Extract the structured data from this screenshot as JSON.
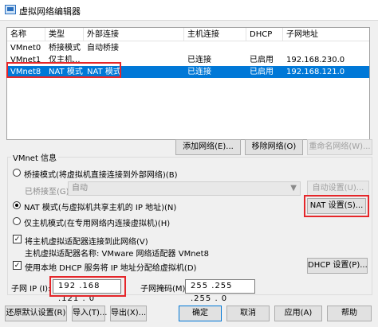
{
  "window": {
    "title": "虚拟网络编辑器"
  },
  "table": {
    "headers": [
      "名称",
      "类型",
      "外部连接",
      "主机连接",
      "DHCP",
      "子网地址"
    ],
    "rows": [
      [
        "VMnet0",
        "桥接模式",
        "自动桥接",
        "",
        "",
        ""
      ],
      [
        "VMnet1",
        "仅主机...",
        "",
        "已连接",
        "已启用",
        "192.168.230.0"
      ],
      [
        "VMnet8",
        "NAT 模式",
        "NAT 模式",
        "已连接",
        "已启用",
        "192.168.121.0"
      ]
    ],
    "selected_row": 2
  },
  "buttons": {
    "add_network": "添加网络(E)...",
    "remove_network": "移除网络(O)",
    "rename_network": "重命名网络(W)...",
    "auto_settings": "自动设置(U)...",
    "nat_settings": "NAT 设置(S)...",
    "dhcp_settings": "DHCP 设置(P)...",
    "restore_defaults": "还原默认设置(R)",
    "import": "导入(T)...",
    "export": "导出(X)...",
    "ok": "确定",
    "cancel": "取消",
    "apply": "应用(A)",
    "help": "帮助"
  },
  "vmnet_info": {
    "group_label": "VMnet 信息",
    "bridged_label": "桥接模式(将虚拟机直接连接到外部网络)(B)",
    "bridged_to_label": "已桥接至(G):",
    "bridged_to_value": "自动",
    "nat_label": "NAT 模式(与虚拟机共享主机的 IP 地址)(N)",
    "hostonly_label": "仅主机模式(在专用网络内连接虚拟机)(H)",
    "connect_adapter_label": "将主机虚拟适配器连接到此网络(V)",
    "adapter_name_label": "主机虚拟适配器名称: VMware 网络适配器 VMnet8",
    "use_dhcp_label": "使用本地 DHCP 服务将 IP 地址分配给虚拟机(D)",
    "mode_selected": "nat",
    "connect_adapter_checked": true,
    "use_dhcp_checked": true
  },
  "subnet": {
    "ip_label": "子网 IP (I):",
    "ip_value": "192 .168 .121 . 0",
    "mask_label": "子网掩码(M):",
    "mask_value": "255 .255 .255 . 0"
  },
  "colors": {
    "selection": "#0078d7",
    "highlight": "#e5262a"
  }
}
